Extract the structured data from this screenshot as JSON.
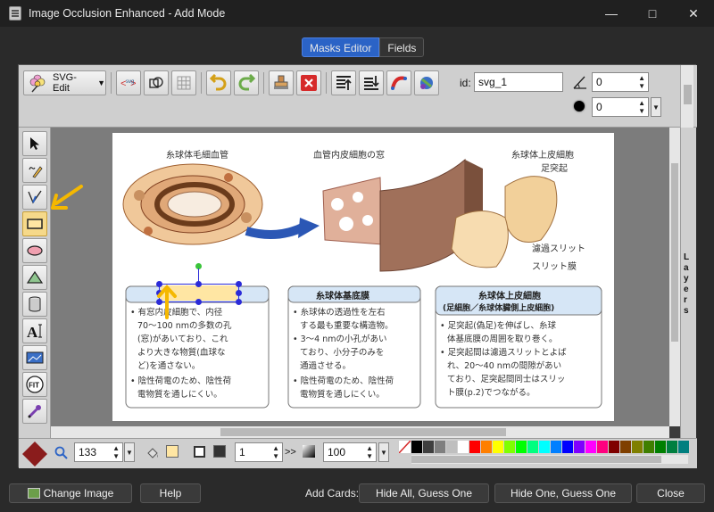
{
  "window": {
    "title": "Image Occlusion Enhanced - Add Mode"
  },
  "tabs": [
    {
      "label": "Masks Editor",
      "active": true
    },
    {
      "label": "Fields",
      "active": false
    }
  ],
  "toolbar": {
    "svgedit_label": "SVG-Edit",
    "id_label": "id:",
    "id_value": "svg_1",
    "angle_value": "0",
    "blur_value": "0"
  },
  "canvas": {
    "image_captions": {
      "left_title": "糸球体毛細血管",
      "middle_title": "血管内皮細胞の窓",
      "right_title": "糸球体上皮細胞\n足突起",
      "filtration_slit": "濾過スリット",
      "slit_membrane": "スリット膜",
      "box1_lines": [
        "有窓内皮細胞で、内径",
        "70〜100 nmの多数の孔",
        "(窓)があいており、これ",
        "より大きな物質(血球な",
        "ど)を通さない。",
        "陰性荷電のため、陰性荷",
        "電物質を通しにくい。"
      ],
      "box2_title": "糸球体基底膜",
      "box2_lines": [
        "糸球体の透過性を左右",
        "する最も重要な構造物。",
        "3〜4 nmの小孔があい",
        "ており、小分子のみを",
        "通過させる。",
        "陰性荷電のため、陰性荷",
        "電物質を通しにくい。"
      ],
      "box3_title": "糸球体上皮細胞",
      "box3_subtitle": "(足細胞／糸球体臓側上皮細胞)",
      "box3_lines": [
        "足突起(偽足)を伸ばし、糸球",
        "体基底膜の周囲を取り巻く。",
        "足突起間は濾過スリットとよば",
        "れ、20〜40 nmの間隙があい",
        "ており、足突起間同士はスリッ",
        "ト膜(p.2)でつながる。"
      ]
    }
  },
  "bottombar": {
    "zoom_value": "133",
    "stroke_width_value": "1",
    "opacity_value": "100",
    "stroke_style_label": ">>"
  },
  "palette_colors": [
    "#ffffff",
    "#000000",
    "#3f3f3f",
    "#7f7f7f",
    "#bfbfbf",
    "#ffffff",
    "#ff0000",
    "#ff7f00",
    "#ffff00",
    "#7fff00",
    "#00ff00",
    "#00ff7f",
    "#00ffff",
    "#007fff",
    "#0000ff",
    "#7f00ff",
    "#ff00ff",
    "#ff007f",
    "#7f0000",
    "#7f3f00",
    "#7f7f00",
    "#3f7f00",
    "#007f00",
    "#007f3f",
    "#007f7f"
  ],
  "side_panel": {
    "layers_label": "Layers"
  },
  "footer": {
    "change_image": "Change Image",
    "help": "Help",
    "add_cards": "Add Cards:",
    "hide_all": "Hide All, Guess One",
    "hide_one": "Hide One, Guess One",
    "close": "Close"
  },
  "colors": {
    "accent": "#2b63c6",
    "annotation": "#f5b800",
    "mask_fill": "#ffe6a3",
    "selection": "#2b2bd8"
  }
}
